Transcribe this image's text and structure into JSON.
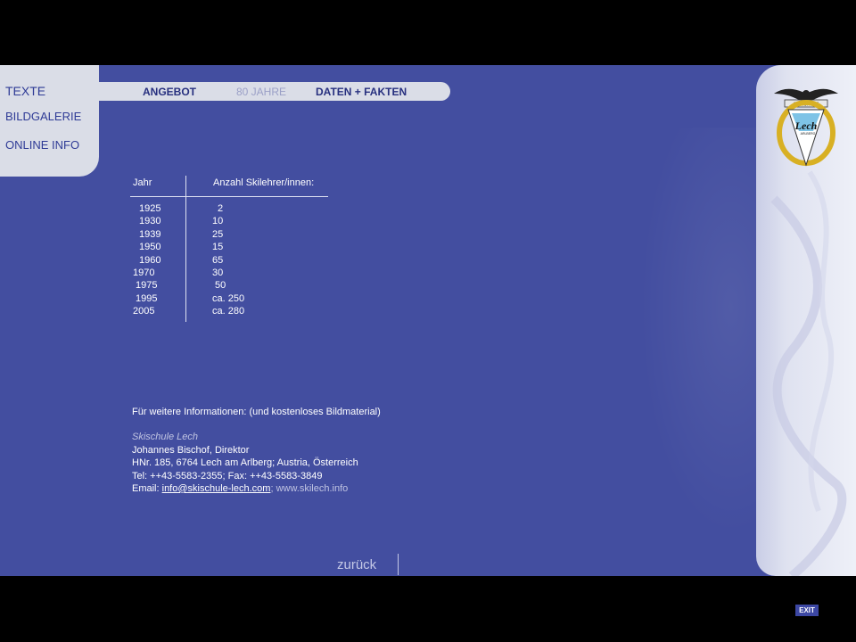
{
  "nav": {
    "left": [
      "TEXTE",
      "BILDGALERIE",
      "ONLINE INFO"
    ],
    "tabs": [
      "ANGEBOT",
      "80 JAHRE",
      "DATEN  + FAKTEN"
    ]
  },
  "table": {
    "headers": [
      "Jahr",
      "Anzahl Skilehrer/innen:"
    ],
    "rows": [
      [
        " 1925",
        " 2"
      ],
      [
        " 1930",
        "10"
      ],
      [
        " 1939",
        "25"
      ],
      [
        " 1950",
        "15"
      ],
      [
        " 1960",
        "65"
      ],
      [
        "1970",
        "30"
      ],
      [
        " 1975",
        " 50"
      ],
      [
        " 1995",
        "ca. 250"
      ],
      [
        "2005",
        "ca. 280"
      ]
    ]
  },
  "info": {
    "intro": "Für weitere Informationen: (und kostenloses Bildmaterial)",
    "company": "Skischule Lech",
    "person": "Johannes Bischof, Direktor",
    "address": "HNr. 185, 6764  Lech am Arlberg; Austria, Österreich",
    "phone": "Tel: ++43-5583-2355; Fax: ++43-5583-3849",
    "email_label": "Email: ",
    "email": "info@skischule-lech.com",
    "web": "; www.skilech.info"
  },
  "logo": {
    "top_text": "SKISCHULE",
    "name": "Lech",
    "sub": "ARLBERG"
  },
  "footer": {
    "back": "zurück",
    "exit": "EXIT"
  }
}
